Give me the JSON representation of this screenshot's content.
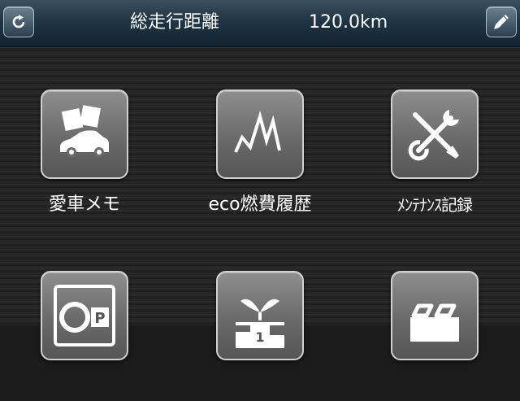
{
  "header": {
    "title": "総走行距離",
    "distance": "120.0km",
    "refresh_icon": "refresh-icon",
    "edit_icon": "edit-pencil-icon"
  },
  "menu": {
    "items": [
      {
        "label": "愛車メモ",
        "icon": "car-memo-icon"
      },
      {
        "label": "eco燃費履歴",
        "icon": "fuel-graph-icon"
      },
      {
        "label": "ﾒﾝﾃﾅﾝｽ記録",
        "icon": "wrench-screwdriver-icon"
      },
      {
        "label": "",
        "icon": "parking-icon"
      },
      {
        "label": "",
        "icon": "eco-ranking-icon"
      },
      {
        "label": "",
        "icon": "tire-icon"
      }
    ]
  },
  "colors": {
    "header": "#1f3444",
    "tile": "#6a6a6a",
    "background": "#252525"
  }
}
